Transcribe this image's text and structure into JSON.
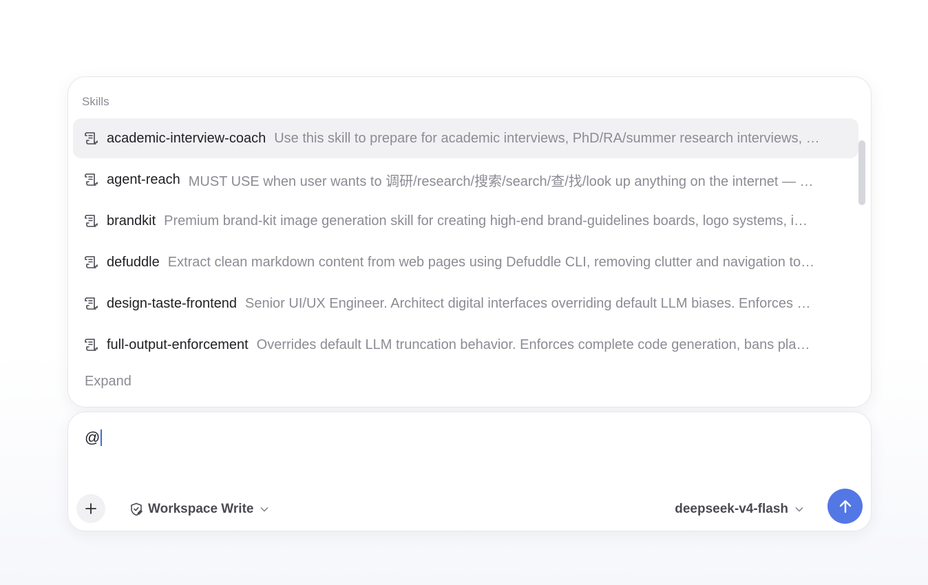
{
  "skills_panel": {
    "heading": "Skills",
    "expand_label": "Expand",
    "items": [
      {
        "name": "academic-interview-coach",
        "description": "Use this skill to prepare for academic interviews, PhD/RA/summer research interviews, …",
        "active": true
      },
      {
        "name": "agent-reach",
        "description": "MUST USE when user wants to 调研/research/搜索/search/查/找/look up anything on the internet — …",
        "active": false
      },
      {
        "name": "brandkit",
        "description": "Premium brand-kit image generation skill for creating high-end brand-guidelines boards, logo systems, i…",
        "active": false
      },
      {
        "name": "defuddle",
        "description": "Extract clean markdown content from web pages using Defuddle CLI, removing clutter and navigation to…",
        "active": false
      },
      {
        "name": "design-taste-frontend",
        "description": "Senior UI/UX Engineer. Architect digital interfaces overriding default LLM biases. Enforces …",
        "active": false
      },
      {
        "name": "full-output-enforcement",
        "description": "Overrides default LLM truncation behavior. Enforces complete code generation, bans pla…",
        "active": false
      }
    ]
  },
  "composer": {
    "input_value": "@",
    "mode_label": "Workspace Write",
    "model_label": "deepseek-v4-flash"
  },
  "icons": {
    "skill": "scroll-icon",
    "add": "plus-icon",
    "mode": "shield-icon",
    "dropdown": "chevron-down-icon",
    "send": "arrow-up-icon"
  },
  "colors": {
    "accent": "#5477e6",
    "active_row": "#f1f1f4",
    "muted_text": "#8b8c94"
  }
}
